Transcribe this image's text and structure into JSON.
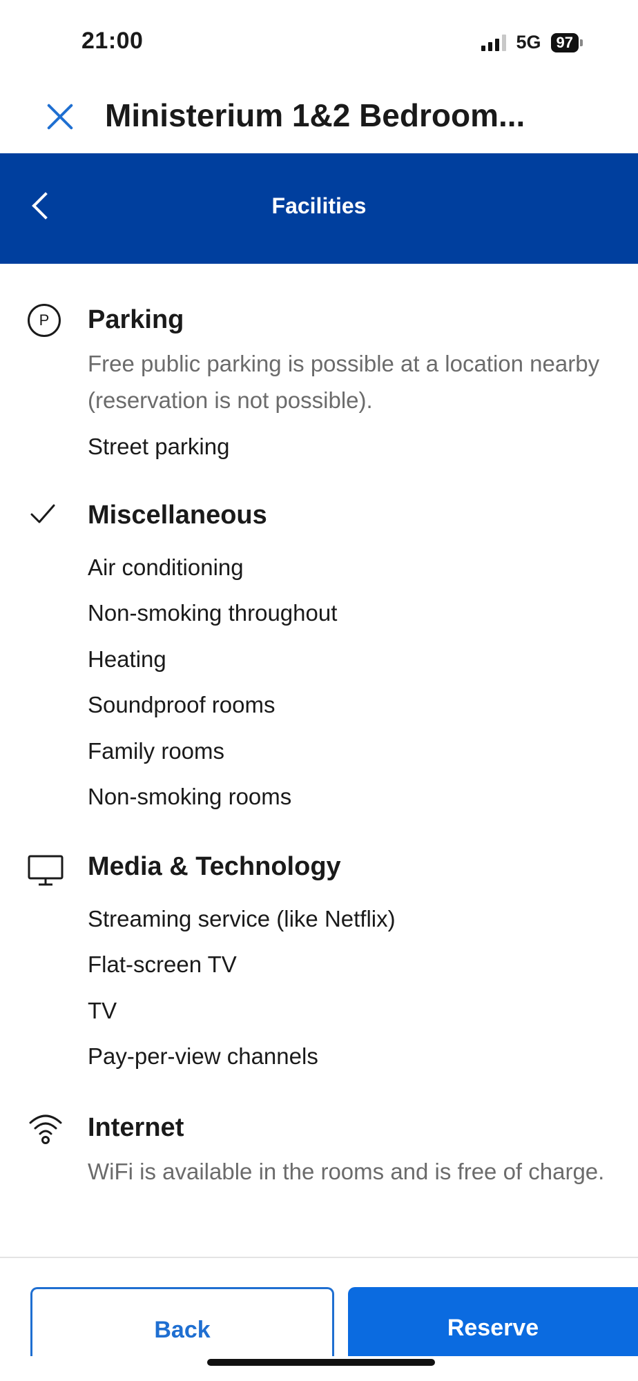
{
  "status_bar": {
    "time": "21:00",
    "network": "5G",
    "battery": "97"
  },
  "header": {
    "title": "Ministerium 1&2 Bedroom...",
    "nav_title": "Facilities"
  },
  "sections": {
    "parking": {
      "icon": "parking-icon",
      "title": "Parking",
      "description": "Free public parking is possible at a location nearby (reservation is not possible).",
      "items": [
        "Street parking"
      ]
    },
    "miscellaneous": {
      "icon": "checkmark-icon",
      "title": "Miscellaneous",
      "items": [
        "Air conditioning",
        "Non-smoking throughout",
        "Heating",
        "Soundproof rooms",
        "Family rooms",
        "Non-smoking rooms"
      ]
    },
    "media": {
      "icon": "monitor-icon",
      "title": "Media & Technology",
      "items": [
        "Streaming service (like Netflix)",
        "Flat-screen TV",
        "TV",
        "Pay-per-view channels"
      ]
    },
    "internet": {
      "icon": "wifi-icon",
      "title": "Internet",
      "description": "WiFi is available in the rooms and is free of charge."
    }
  },
  "footer": {
    "back_label": "Back",
    "reserve_label": "Reserve"
  },
  "colors": {
    "header_blue": "#003f9e",
    "accent_blue": "#1f6fd1",
    "button_blue": "#0b6be0"
  }
}
